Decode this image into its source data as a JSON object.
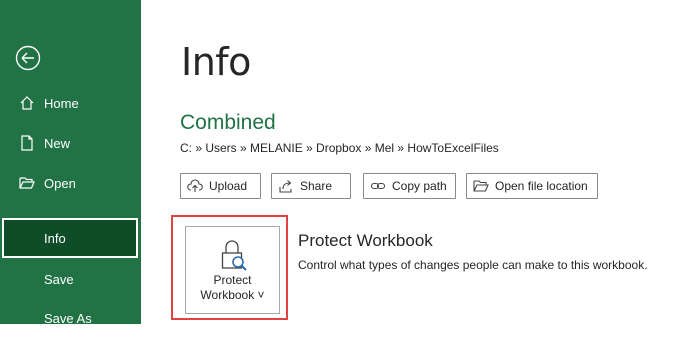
{
  "sidebar": {
    "back_icon": "arrow-left-circle-icon",
    "items": [
      {
        "label": "Home",
        "icon": "home-icon"
      },
      {
        "label": "New",
        "icon": "new-document-icon"
      },
      {
        "label": "Open",
        "icon": "folder-open-icon"
      },
      {
        "label": "Info",
        "selected": true
      },
      {
        "label": "Save"
      },
      {
        "label": "Save As"
      }
    ]
  },
  "main": {
    "title": "Info",
    "file_name": "Combined",
    "file_path": "C: » Users » MELANIE » Dropbox » Mel » HowToExcelFiles",
    "actions": [
      {
        "label": "Upload",
        "icon": "upload-icon"
      },
      {
        "label": "Share",
        "icon": "share-icon"
      },
      {
        "label": "Copy path",
        "icon": "link-icon"
      },
      {
        "label": "Open file location",
        "icon": "folder-icon"
      }
    ],
    "protect": {
      "button_line1": "Protect",
      "button_line2": "Workbook ˅",
      "icon": "lock-search-icon",
      "title": "Protect Workbook",
      "description": "Control what types of changes people can make to this workbook."
    }
  },
  "colors": {
    "sidebar": "#217346",
    "selected": "#0e4d28",
    "accent": "#217346",
    "highlight": "#e04343"
  }
}
